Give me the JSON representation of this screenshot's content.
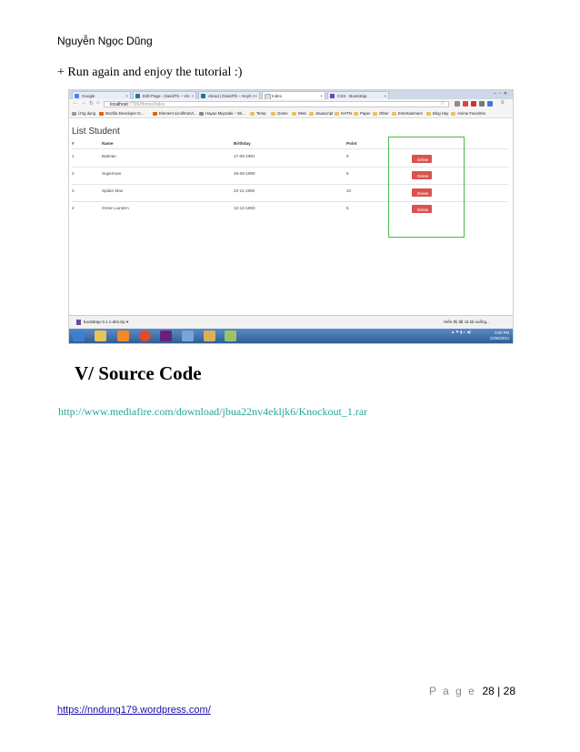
{
  "header": {
    "author": "Nguyễn Ngọc Dũng"
  },
  "intro": "+ Run again and enjoy the tutorial :)",
  "screenshot": {
    "tabs": [
      {
        "label": "Google",
        "color": "#4285f4"
      },
      {
        "label": "Edit Page ‹ DavidTk – Vin",
        "color": "#21759b"
      },
      {
        "label": "About | DavidTk – Hoyh ×",
        "color": "#21759b"
      },
      {
        "label": "Index",
        "color": "#cccccc"
      },
      {
        "label": "CSS · Bootstrap",
        "color": "#6f42c1"
      }
    ],
    "url_host": "localhost",
    "url_path": ":7796/Home/Index",
    "bookmarks": [
      "Ứng dụng",
      "Mozilla Developer N...",
      "Element.scrollIntoVi...",
      "Hayao Miyazaki – Wi...",
      "Temp",
      "Game",
      "Web",
      "Javascript",
      "KHTN",
      "Paper",
      "Other",
      "Entertainment",
      "Blog Hay",
      "Anime Favorites"
    ],
    "page_title": "List Student",
    "columns": [
      "#",
      "Name",
      "Birthday",
      "Point"
    ],
    "rows": [
      {
        "id": "1",
        "name": "Batman",
        "birthday": "17-08-1991",
        "point": "9"
      },
      {
        "id": "2",
        "name": "Superman",
        "birthday": "25-06-1990",
        "point": "6"
      },
      {
        "id": "3",
        "name": "Spider Man",
        "birthday": "22-11-1990",
        "point": "10"
      },
      {
        "id": "4",
        "name": "Green Lantern",
        "birthday": "12-12-1993",
        "point": "6"
      }
    ],
    "delete_label": "Delete",
    "download_item": "bootstrap-3.1.1-dist.zip",
    "show_all_downloads": "Hiển thị tất cả tải xuống...",
    "clock_time": "5:00 PM",
    "clock_date": "22/06/2014",
    "colors": {
      "delete": "#d9534f",
      "highlight": "#4ab84a"
    }
  },
  "section_heading": "V/ Source Code",
  "source_link": "http://www.mediafire.com/download/jbua22nv4ekljk6/Knockout_1.rar",
  "footer": {
    "page_label": "P a g e",
    "page_current": "28",
    "page_total": "28",
    "site_url": "https://nndung179.wordpress.com/"
  }
}
